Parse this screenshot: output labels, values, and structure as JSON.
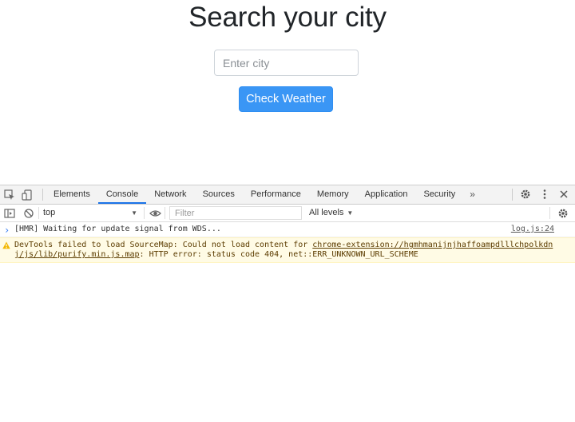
{
  "app": {
    "title": "Search your city",
    "input_placeholder": "Enter city",
    "button_label": "Check Weather"
  },
  "devtools": {
    "tabs": [
      {
        "label": "Elements",
        "active": false
      },
      {
        "label": "Console",
        "active": true
      },
      {
        "label": "Network",
        "active": false
      },
      {
        "label": "Sources",
        "active": false
      },
      {
        "label": "Performance",
        "active": false
      },
      {
        "label": "Memory",
        "active": false
      },
      {
        "label": "Application",
        "active": false
      },
      {
        "label": "Security",
        "active": false
      }
    ],
    "more_tabs": "»",
    "context": "top",
    "filter_placeholder": "Filter",
    "levels": "All levels",
    "messages": {
      "hmr_text": "[HMR] Waiting for update signal from WDS...",
      "hmr_source": "log.js:24",
      "warn_prefix": "DevTools failed to load SourceMap: Could not load content for ",
      "warn_link": "chrome-extension://hgmhmanijnjhaffoampdlllchpolkdnj/js/lib/purify.min.js.map",
      "warn_suffix": ": HTTP error: status code 404, net::ERR_UNKNOWN_URL_SCHEME"
    },
    "prompt": "›"
  },
  "colors": {
    "button": "#3a96f5",
    "active_tab": "#1a73e8",
    "warning_bg": "#fffbe5"
  }
}
